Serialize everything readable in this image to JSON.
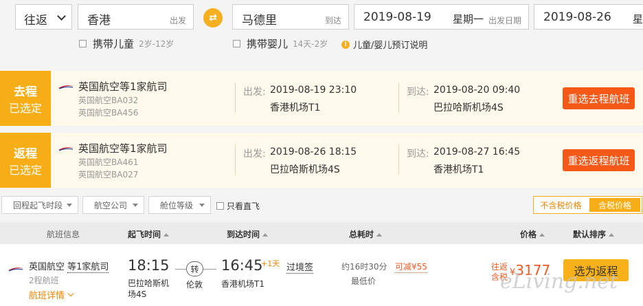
{
  "search": {
    "trip_type": "往返",
    "from_city": "香港",
    "from_hint": "出发",
    "to_city": "马德里",
    "to_hint": "到达",
    "depart_date": "2019-08-19",
    "depart_weekday": "星期一",
    "depart_hint": "出发日期",
    "return_date": "2019-08-26",
    "return_weekday": "星",
    "child_label": "携带儿童",
    "child_age": "2岁-12岁",
    "infant_label": "携带婴儿",
    "infant_age": "14天-2岁",
    "booking_note": "儿童/婴儿预订说明"
  },
  "legs": [
    {
      "badge_title": "去程",
      "badge_status": "已选定",
      "airline": "英国航空等1家航司",
      "flight_a": "英国航空BA032",
      "flight_b": "英国航空BA456",
      "depart_label": "出发:",
      "depart_time": "2019-08-19 23:10",
      "depart_place": "香港机场T1",
      "arrive_label": "到达:",
      "arrive_time": "2019-08-20 09:40",
      "arrive_place": "巴拉哈斯机场4S",
      "button": "重选去程航班"
    },
    {
      "badge_title": "返程",
      "badge_status": "已选定",
      "airline": "英国航空等1家航司",
      "flight_a": "英国航空BA461",
      "flight_b": "英国航空BA027",
      "depart_label": "出发:",
      "depart_time": "2019-08-26 18:15",
      "depart_place": "巴拉哈斯机场4S",
      "arrive_label": "到达:",
      "arrive_time": "2019-08-27 16:45",
      "arrive_place": "香港机场T1",
      "button": "重选返程航班"
    }
  ],
  "filters": {
    "departure_period": "回程起飞时段",
    "airline": "航空公司",
    "cabin": "舱位等级",
    "direct_only": "只看直飞",
    "tax_excluded": "不含税价格",
    "tax_included": "含税价格"
  },
  "table_header": {
    "flight_info": "航班信息",
    "depart_time": "起飞时间",
    "arrive_time": "到达时间",
    "duration": "总耗时",
    "price": "价格",
    "sort": "默认排序"
  },
  "flight": {
    "airline": "英国航空",
    "airline_more": "等1家航司",
    "legs": "2程航班",
    "details": "航班详情",
    "depart_time": "18:15",
    "depart_place": "巴拉哈斯机场4S",
    "transfer": "转",
    "transfer_city": "伦敦",
    "arrive_time": "16:45",
    "arrive_day": "+1天",
    "arrive_place": "香港机场T1",
    "visa": "过境签",
    "duration": "约16时30分",
    "lowest": "最低价",
    "discount": "可减¥55",
    "price_label_a": "往返",
    "price_label_b": "含税",
    "currency": "¥",
    "price": "3177",
    "choose_button": "选为返程"
  },
  "watermark": "eLiving.net",
  "colors": {
    "accent_orange": "#f7ae16",
    "reselect_red": "#f65817",
    "price_red": "#f05b24",
    "leg_bg": "#fff9ec"
  }
}
